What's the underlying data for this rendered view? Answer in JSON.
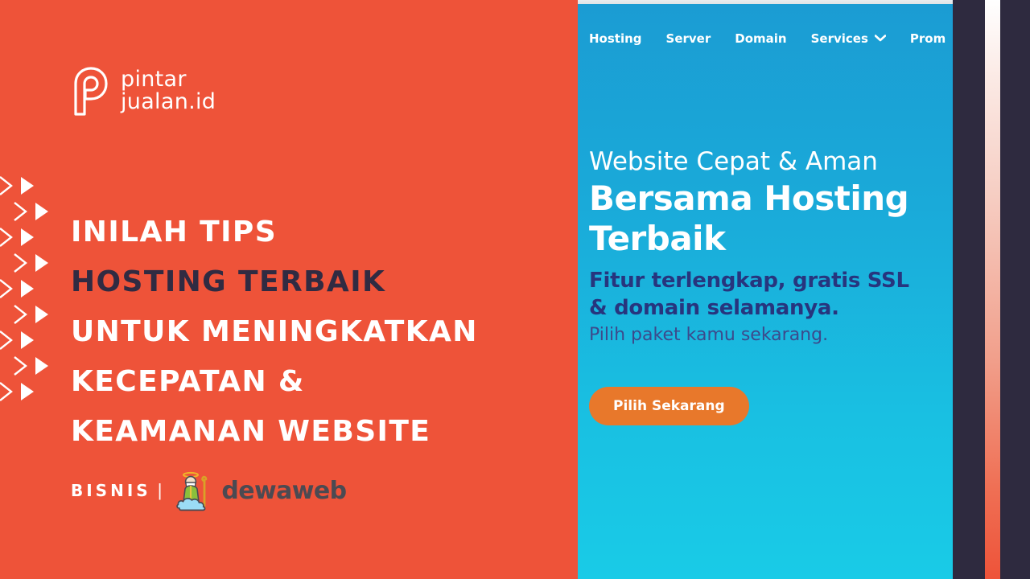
{
  "left_panel": {
    "background_color": "#ee5339",
    "brand": {
      "icon": "pintarjualan-p-logo-icon",
      "line1": "pintar",
      "line2": "jualan.id"
    },
    "headline": {
      "lines": [
        {
          "text": "INILAH TIPS",
          "color": "#ffffff"
        },
        {
          "text": "HOSTING TERBAIK",
          "color": "#302b42"
        },
        {
          "text": "UNTUK MENINGKATKAN",
          "color": "#ffffff"
        },
        {
          "text": "KECEPATAN &",
          "color": "#ffffff"
        },
        {
          "text": "KEAMANAN WEBSITE",
          "color": "#ffffff"
        }
      ]
    },
    "credit": {
      "category": "BISNIS",
      "separator": "|",
      "partner_icon": "dewaweb-sage-cloud-logo-icon",
      "partner_name": "dewaweb"
    },
    "decoration": {
      "icon": "double-chevron-pattern-icon",
      "rows": 9
    }
  },
  "browser_screenshot": {
    "nav": {
      "items": [
        {
          "label": "Hosting",
          "has_caret": false
        },
        {
          "label": "Server",
          "has_caret": false
        },
        {
          "label": "Domain",
          "has_caret": false
        },
        {
          "label": "Services",
          "has_caret": true,
          "caret_icon": "chevron-down-icon"
        },
        {
          "label": "Prom",
          "has_caret": false
        }
      ]
    },
    "hero": {
      "title_light": "Website Cepat & Aman",
      "title_bold_line1": "Bersama Hosting",
      "title_bold_line2": "Terbaik",
      "subtitle_line1": "Fitur terlengkap, gratis SSL",
      "subtitle_line2": "& domain selamanya.",
      "note": "Pilih paket kamu sekarang.",
      "cta_label": "Pilih Sekarang",
      "cta_color": "#e8782b",
      "gradient_top": "#1b9cd3",
      "gradient_bottom": "#19cbe7",
      "subtitle_color": "#27357e"
    }
  },
  "right_bands": {
    "navy_color": "#2e2a3f",
    "gradient_from": "#ffffff",
    "gradient_to": "#ee5339"
  }
}
